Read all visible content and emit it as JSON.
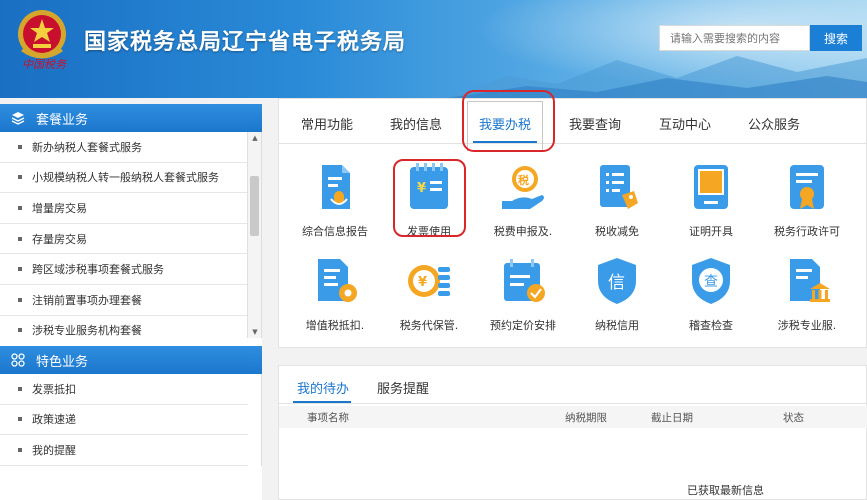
{
  "header": {
    "title": "国家税务总局辽宁省电子税务局",
    "logo_text": "中国税务",
    "search": {
      "placeholder": "请输入需要搜索的内容",
      "button": "搜索"
    }
  },
  "sidebar": {
    "section1": {
      "title": "套餐业务",
      "items": [
        "新办纳税人套餐式服务",
        "小规模纳税人转一般纳税人套餐式服务",
        "增量房交易",
        "存量房交易",
        "跨区域涉税事项套餐式服务",
        "注销前置事项办理套餐",
        "涉税专业服务机构套餐"
      ]
    },
    "section2": {
      "title": "特色业务",
      "items": [
        "发票抵扣",
        "政策速递",
        "我的提醒"
      ]
    }
  },
  "main": {
    "tabs": [
      "常用功能",
      "我的信息",
      "我要办税",
      "我要查询",
      "互动中心",
      "公众服务"
    ],
    "functions": [
      {
        "label": "综合信息报告",
        "icon": "report-mic-icon"
      },
      {
        "label": "发票使用",
        "icon": "invoice-yen-icon"
      },
      {
        "label": "税费申报及.",
        "icon": "tax-declare-hand-icon"
      },
      {
        "label": "税收减免",
        "icon": "tax-relief-tag-icon"
      },
      {
        "label": "证明开具",
        "icon": "certificate-icon"
      },
      {
        "label": "税务行政许可",
        "icon": "admin-permit-ribbon-icon"
      },
      {
        "label": "增值税抵扣.",
        "icon": "vat-deduct-gear-icon"
      },
      {
        "label": "税务代保管.",
        "icon": "tax-custody-coin-icon"
      },
      {
        "label": "预约定价安排",
        "icon": "pricing-calendar-check-icon"
      },
      {
        "label": "纳税信用",
        "icon": "credit-shield-icon"
      },
      {
        "label": "稽查检查",
        "icon": "inspection-shield-icon"
      },
      {
        "label": "涉税专业服.",
        "icon": "professional-service-bank-icon"
      }
    ]
  },
  "todo": {
    "tabs": [
      "我的待办",
      "服务提醒"
    ],
    "columns": [
      "事项名称",
      "纳税期限",
      "截止日期",
      "状态"
    ],
    "empty_message": "已获取最新信息"
  },
  "colors": {
    "brand_blue": "#1b77cc",
    "highlight_red": "#d9262a",
    "icon_blue": "#2a90e8",
    "icon_orange": "#f5a623"
  }
}
